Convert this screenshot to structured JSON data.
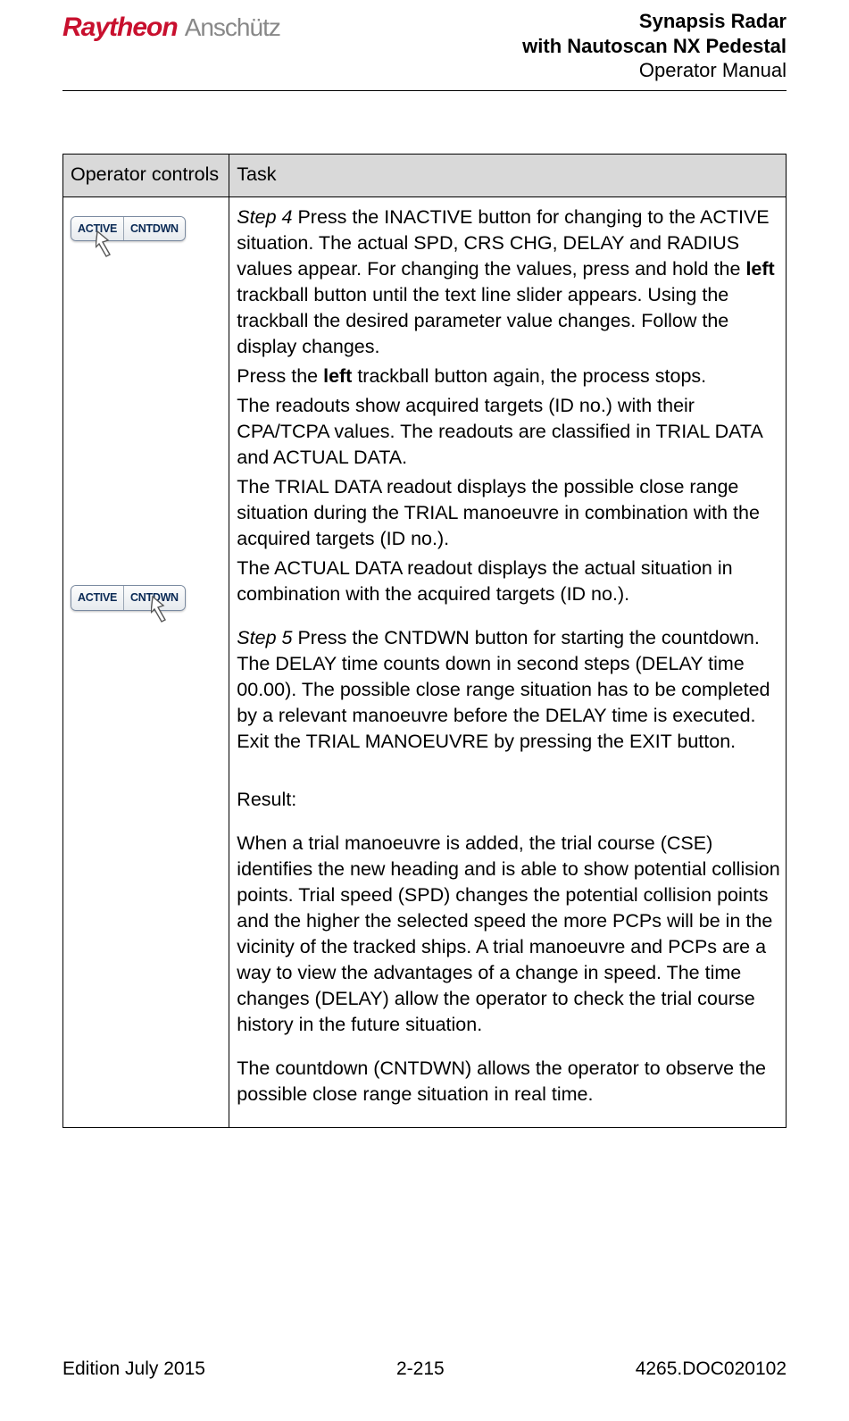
{
  "header": {
    "logo_raytheon": "Raytheon",
    "logo_anschutz": "Anschütz",
    "title_line1": "Synapsis Radar",
    "title_line2": "with Nautoscan NX Pedestal",
    "title_line3": "Operator Manual"
  },
  "table": {
    "col1_header": "Operator controls",
    "col2_header": "Task",
    "btn_active": "ACTIVE",
    "btn_cntdwn": "CNTDWN",
    "step4_label": "Step 4",
    "step4_text_part1": "  Press the INACTIVE button for changing to the ACTIVE situation. The actual SPD, CRS CHG, DELAY and RADIUS values appear. For changing the values, press and hold the ",
    "step4_bold_left1": "left",
    "step4_text_part2": " trackball button until the text line slider appears. Using the trackball the desired parameter value changes. Follow the display changes.",
    "step4_line2a": "Press the ",
    "step4_bold_left2": "left",
    "step4_line2b": " trackball button again, the process stops.",
    "step4_line3": "The readouts show acquired targets (ID no.) with their CPA/TCPA values. The readouts are classified in TRIAL DATA and ACTUAL DATA.",
    "step4_line4": "The TRIAL DATA readout displays the possible close range situation during the TRIAL manoeuvre in combination with the acquired targets (ID no.).",
    "step4_line5": "The ACTUAL DATA readout displays the actual situation in combination with the acquired targets (ID no.).",
    "step5_label": "Step 5",
    "step5_text": " Press the CNTDWN button for starting the countdown. The DELAY time counts down in second steps (DELAY time 00.00). The possible close range situation has to be completed by a relevant manoeuvre before the DELAY time is executed. Exit the TRIAL MANOEUVRE by pressing the EXIT button.",
    "result_label": "Result:",
    "result_p1": "When a trial manoeuvre is added, the trial course (CSE) identifies the new heading and is able to show potential collision points. Trial speed (SPD) changes the potential collision points and the higher the selected speed the more PCPs will be in the vicinity of the tracked ships. A trial manoeuvre and PCPs are a way to view the advantages of a change in speed. The time changes (DELAY) allow the operator to check the trial course history in the future situation.",
    "result_p2": "The countdown (CNTDWN) allows the operator to observe the possible close range situation in real time."
  },
  "footer": {
    "left": "Edition July 2015",
    "center": "2-215",
    "right": "4265.DOC020102"
  }
}
